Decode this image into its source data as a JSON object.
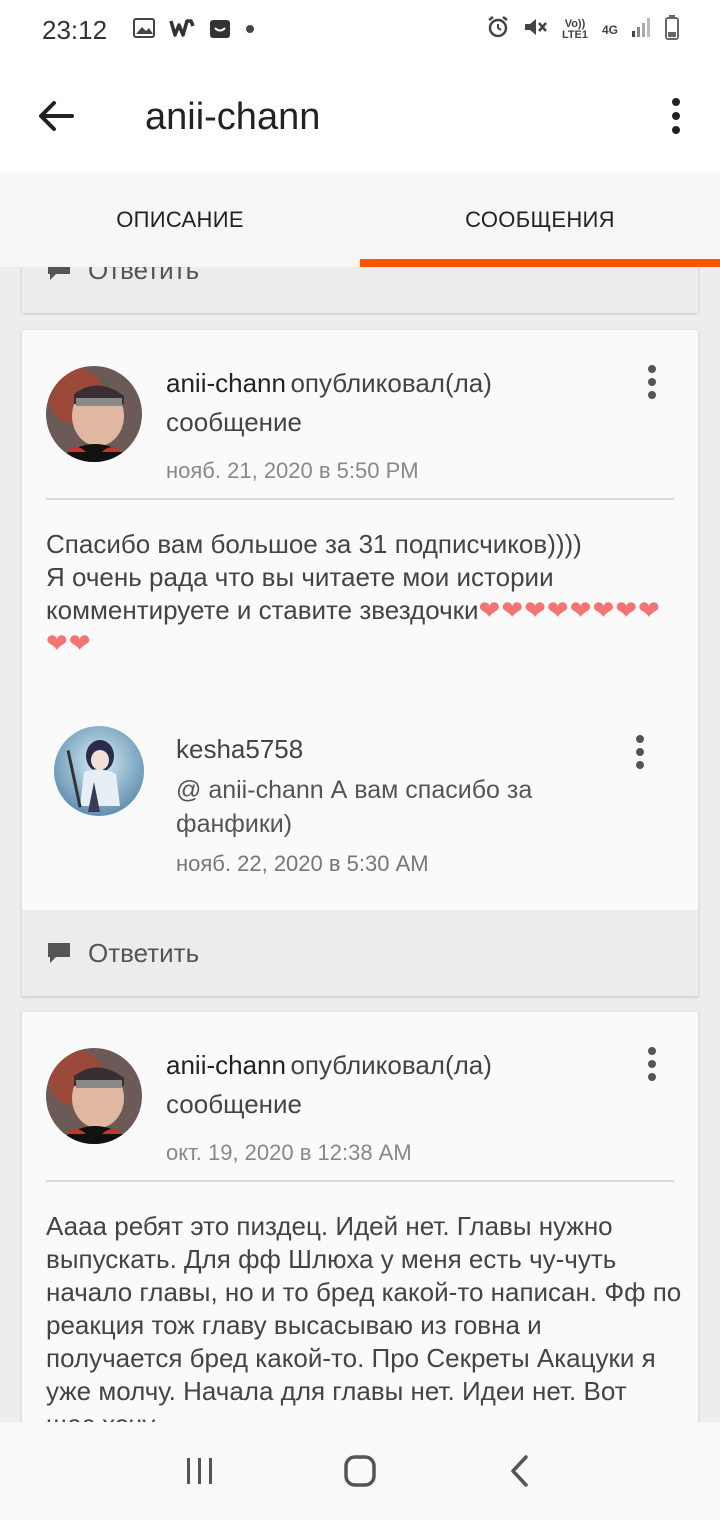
{
  "status_bar": {
    "time": "23:12",
    "left_icons": [
      "image-icon",
      "wattpad-icon",
      "store-icon",
      "dot-icon"
    ],
    "right_icons": [
      "alarm-icon",
      "mute-icon",
      "volte-icon",
      "4g-icon",
      "signal-icon",
      "battery-icon"
    ],
    "volte_label": "Vo)) LTE1",
    "net_label": "4G"
  },
  "app_bar": {
    "title": "anii-chann"
  },
  "tabs": [
    {
      "label": "ОПИСАНИЕ",
      "active": false
    },
    {
      "label": "СООБЩЕНИЯ",
      "active": true
    }
  ],
  "reply_label": "Ответить",
  "posts": [
    {
      "author": "anii-chann",
      "action": "опубликовал(ла) сообщение",
      "date": "нояб. 21, 2020 в 5:50 PM",
      "body_line1": "Спасибо вам большое за 31 подписчиков))))",
      "body_line2": "Я очень рада что вы читаете мои истории комментируете и ставите звездочки",
      "hearts": "❤❤❤❤❤❤❤❤❤❤",
      "reply": {
        "author": "kesha5758",
        "text": "@ anii-chann  А вам спасибо за фанфики)",
        "date": "нояб. 22, 2020 в 5:30 AM"
      }
    },
    {
      "author": "anii-chann",
      "action": "опубликовал(ла) сообщение",
      "date": "окт. 19, 2020 в 12:38 AM",
      "body": "Аааа ребят это пиздец. Идей нет. Главы нужно выпускать. Для фф Шлюха у меня есть чу-чуть начало главы, но и то бред какой-то написан. Фф по реакция тож главу высасываю из говна и  получается бред какой-то. Про Секреты Акацуки я уже молчу. Начала для главы нет. Идеи нет. Вот щас хочу"
    }
  ],
  "colors": {
    "accent": "#ff5500",
    "heart": "#f47373"
  }
}
